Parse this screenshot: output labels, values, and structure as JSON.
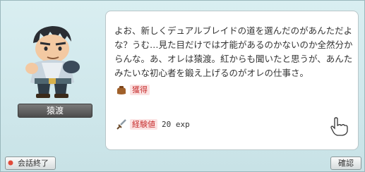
{
  "npc": {
    "name": "猿渡"
  },
  "dialog": {
    "text": "よお、新しくデュアルブレイドの道を選んだのがあんただよな？うむ…見た目だけでは才能があるのかないのか全然分からんな。あ、オレは猿渡。紅からも聞いたと思うが、あんたみたいな初心者を鍛え上げるのがオレの仕事さ。"
  },
  "rewards": {
    "item_label": "獲得",
    "exp_label": "経験値",
    "exp_value": "20 exp"
  },
  "buttons": {
    "end_conversation": "会話終了",
    "confirm": "確認"
  },
  "icons": {
    "reward_item": "bag-icon",
    "reward_exp": "sword-icon",
    "cursor": "pointing-hand-icon",
    "end_indicator": "red-dot-icon"
  }
}
